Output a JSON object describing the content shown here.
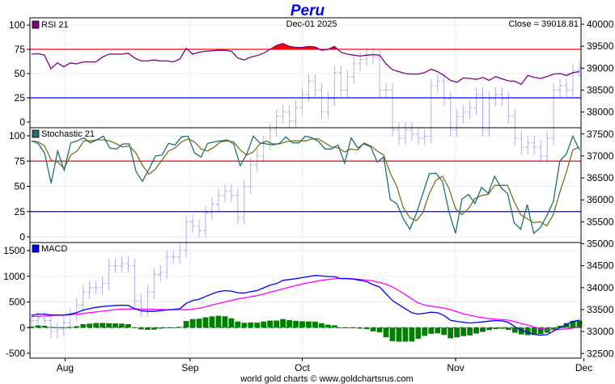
{
  "title": "Peru",
  "date_label": "Dec-01  2025",
  "close_label": "Close = 39018.81",
  "footer": "world gold charts © www.goldchartsrus.com",
  "colors": {
    "rsi": "#800080",
    "stoch_k": "#1f7070",
    "stoch_d": "#7a7020",
    "macd": "#0000ff",
    "signal": "#ff00ff",
    "hist": "#008000",
    "price": "#b0b0f0",
    "overbought": "#ff0000",
    "oversold": "#0000ff",
    "grid": "#e4eef8"
  },
  "chart_data": {
    "type": "line",
    "x_months": [
      "Aug",
      "Sep",
      "Oct",
      "Nov",
      "Dec"
    ],
    "x_month_index": [
      5.2,
      24.6,
      42,
      65.8,
      85.7
    ],
    "price": {
      "name": "Close",
      "axis": "right",
      "ticks": [
        "40000",
        "39500",
        "39000",
        "38500",
        "38000",
        "37500",
        "37000",
        "36500",
        "36000",
        "35500",
        "35000",
        "34500",
        "34000",
        "33500",
        "33000",
        "32500"
      ],
      "ylim": [
        32500,
        40000
      ],
      "close": [
        33250,
        33300,
        33250,
        33000,
        33050,
        33200,
        33400,
        33600,
        33900,
        34000,
        34000,
        34100,
        34500,
        34500,
        34550,
        34500,
        33700,
        33500,
        33900,
        34300,
        34350,
        34700,
        34700,
        34850,
        35500,
        35400,
        35300,
        35700,
        35900,
        36100,
        36200,
        36100,
        35600,
        36300,
        36800,
        37000,
        37300,
        37600,
        37900,
        38000,
        37800,
        38100,
        38400,
        38700,
        38500,
        38000,
        38300,
        38900,
        38500,
        38800,
        39100,
        39200,
        39300,
        39250,
        38500,
        38500,
        37600,
        37400,
        37600,
        37500,
        37400,
        37450,
        38600,
        38700,
        38300,
        37600,
        37900,
        38000,
        38100,
        38400,
        37600,
        38300,
        38400,
        38300,
        37900,
        37400,
        37200,
        37300,
        37200,
        37000,
        37400,
        38500,
        38600,
        38500,
        38950,
        39018.81
      ]
    },
    "rsi": {
      "name": "RSI 21",
      "ticks": [
        "100",
        "75",
        "50",
        "25",
        "0"
      ],
      "ylim": [
        0,
        100
      ],
      "overbought": 75,
      "oversold": 25,
      "values": [
        70,
        70.5,
        69,
        55,
        61,
        57,
        61,
        60,
        62,
        62,
        62,
        67,
        70,
        70,
        70,
        71,
        66,
        63,
        63,
        64,
        63,
        63,
        62,
        65,
        76,
        70,
        72,
        73,
        73.5,
        74,
        74,
        73,
        66,
        64,
        67,
        68.5,
        71,
        75,
        79,
        81,
        78,
        77,
        77,
        78,
        77.5,
        74,
        75,
        78,
        72,
        70,
        69,
        68,
        69,
        69.5,
        69,
        60,
        54,
        52,
        50,
        49.5,
        49.5,
        51,
        54.5,
        52,
        48,
        43,
        41,
        45.5,
        45,
        44,
        46,
        43,
        47,
        44.5,
        42.5,
        42,
        39,
        48,
        46,
        45,
        47,
        49.5,
        50,
        48,
        51,
        52
      ]
    },
    "stochastic": {
      "name": "Stochastic 21",
      "ticks": [
        "100",
        "75",
        "50",
        "25",
        "0"
      ],
      "ylim": [
        0,
        100
      ],
      "overbought": 75,
      "oversold": 25,
      "k": [
        95,
        92.5,
        83,
        53,
        85,
        66,
        93,
        95,
        98,
        93,
        96,
        99.7,
        88,
        87,
        92,
        92,
        65,
        55,
        67,
        80,
        81,
        92.5,
        91,
        99,
        99.7,
        83,
        79,
        92.5,
        94,
        95,
        96,
        92,
        70.5,
        82,
        99.7,
        93,
        92,
        91,
        92.5,
        99,
        93,
        93,
        99.7,
        98,
        94.5,
        87,
        87,
        91,
        73,
        98,
        88,
        92,
        89,
        74,
        79,
        37,
        33,
        18,
        7.5,
        23,
        43,
        62.5,
        63,
        55,
        25,
        3.5,
        37.5,
        42,
        33,
        49,
        43,
        60,
        48.5,
        43,
        14,
        7.5,
        32,
        3.5,
        9,
        21,
        35,
        75,
        82,
        99.7,
        86
      ],
      "d": [
        95,
        94,
        90,
        76,
        74,
        68,
        81,
        85,
        95,
        95,
        96,
        96,
        95,
        92,
        89,
        90,
        83,
        71,
        62,
        67,
        76,
        85,
        88,
        94,
        97,
        94,
        87,
        85,
        89,
        94,
        95,
        94,
        86,
        81,
        84,
        92,
        95,
        92,
        92,
        94,
        95,
        95,
        95,
        97,
        97,
        93,
        89,
        88,
        84,
        87,
        86,
        93,
        90,
        85,
        81,
        63,
        50,
        29,
        19,
        16,
        24,
        43,
        56,
        60,
        48,
        28,
        22,
        28,
        38,
        41,
        42,
        51,
        51,
        51,
        35,
        22,
        18,
        14,
        15,
        11,
        22,
        44,
        64,
        86,
        89
      ]
    },
    "macd": {
      "name": "MACD",
      "ticks": [
        "1500",
        "1000",
        "500",
        "0",
        "-500"
      ],
      "ylim": [
        -500,
        1500
      ],
      "macd": [
        237,
        263,
        263,
        247,
        247,
        247,
        263,
        290,
        342,
        368,
        395,
        411,
        421,
        432,
        437,
        432,
        368,
        326,
        316,
        316,
        332,
        342,
        353,
        368,
        474,
        526,
        553,
        605,
        658,
        700,
        721,
        711,
        679,
        674,
        700,
        721,
        774,
        826,
        858,
        921,
        937,
        953,
        974,
        995,
        1016,
        1005,
        995,
        995,
        953,
        953,
        942,
        921,
        895,
        837,
        789,
        658,
        526,
        447,
        368,
        289,
        263,
        279,
        300,
        289,
        237,
        142,
        121,
        105,
        89,
        100,
        111,
        126,
        137,
        132,
        100,
        16,
        -53,
        -95,
        -132,
        -147,
        -137,
        -68,
        0,
        63,
        121,
        147
      ],
      "signal": [
        215,
        220,
        228,
        235,
        240,
        243,
        250,
        262,
        275,
        290,
        305,
        320,
        335,
        350,
        360,
        365,
        363,
        360,
        358,
        355,
        352,
        350,
        350,
        353,
        345,
        360,
        380,
        405,
        440,
        470,
        500,
        530,
        560,
        580,
        600,
        625,
        655,
        690,
        720,
        755,
        790,
        820,
        850,
        875,
        900,
        920,
        940,
        950,
        958,
        958,
        950,
        940,
        925,
        910,
        880,
        845,
        790,
        720,
        640,
        560,
        480,
        440,
        420,
        400,
        380,
        350,
        310,
        270,
        240,
        215,
        195,
        175,
        165,
        155,
        145,
        115,
        80,
        50,
        10,
        -20,
        -37,
        -40,
        -35,
        -25,
        -10,
        10
      ]
    }
  }
}
